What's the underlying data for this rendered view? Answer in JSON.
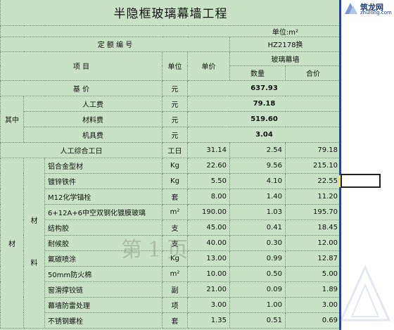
{
  "title": "半隐框玻璃幕墙工程",
  "unit_label": "单位:m²",
  "header": {
    "quota_label": "定  额  编  号",
    "quota_code": "HZ2178换",
    "item_label": "项      目",
    "unit_col": "单位",
    "price_col": "单价",
    "group_label": "玻璃幕墙",
    "qty_col": "数量",
    "total_col": "合价"
  },
  "summary": {
    "base_price_label": "基    价",
    "base_price_unit": "元",
    "base_price_value": "637.93",
    "qizhong": "其中",
    "labor_label": "人工费",
    "labor_unit": "元",
    "labor_value": "79.18",
    "material_label": "材料费",
    "material_unit": "元",
    "material_value": "519.60",
    "machine_label": "机具费",
    "machine_unit": "元",
    "machine_value": "3.04"
  },
  "labor_row": {
    "label": "人工综合工日",
    "unit": "工日",
    "price": "31.14",
    "qty": "2.54",
    "total": "79.18"
  },
  "material_group": {
    "outer_label": "材",
    "inner_label_top": "材",
    "inner_label_bottom": "料"
  },
  "materials": [
    {
      "name": "铝合金型材",
      "unit": "Kg",
      "price": "22.60",
      "qty": "9.56",
      "total": "215.10"
    },
    {
      "name": "镀锌铁件",
      "unit": "Kg",
      "price": "5.50",
      "qty": "4.10",
      "total": "22.55"
    },
    {
      "name": "M12化学锚栓",
      "unit": "套",
      "price": "8.00",
      "qty": "1.40",
      "total": "11.20"
    },
    {
      "name": "6+12A+6中空双钢化镀膜玻璃",
      "unit": "m²",
      "price": "190.00",
      "qty": "1.03",
      "total": "195.70"
    },
    {
      "name": "结构胶",
      "unit": "支",
      "price": "45.00",
      "qty": "0.41",
      "total": "18.45"
    },
    {
      "name": "耐候胶",
      "unit": "支",
      "price": "40.00",
      "qty": "0.30",
      "total": "12.00"
    },
    {
      "name": "氟碳喷涂",
      "unit": "Kg",
      "price": "13.00",
      "qty": "0.99",
      "total": "12.87"
    },
    {
      "name": "50mm防火棉",
      "unit": "m²",
      "price": "10.00",
      "qty": "0.50",
      "total": "5.00"
    },
    {
      "name": "窗滑撑铰链",
      "unit": "副",
      "price": "21.00",
      "qty": "0.09",
      "total": "1.89"
    },
    {
      "name": "幕墙防雷处理",
      "unit": "项",
      "price": "3.00",
      "qty": "1.00",
      "total": "3.00"
    },
    {
      "name": "不锈钢螺栓",
      "unit": "套",
      "price": "1.35",
      "qty": "0.51",
      "total": "0.69"
    }
  ],
  "watermark_text": "第1页",
  "logo": {
    "name": "筑龙网",
    "sub": "zhulong.com"
  }
}
